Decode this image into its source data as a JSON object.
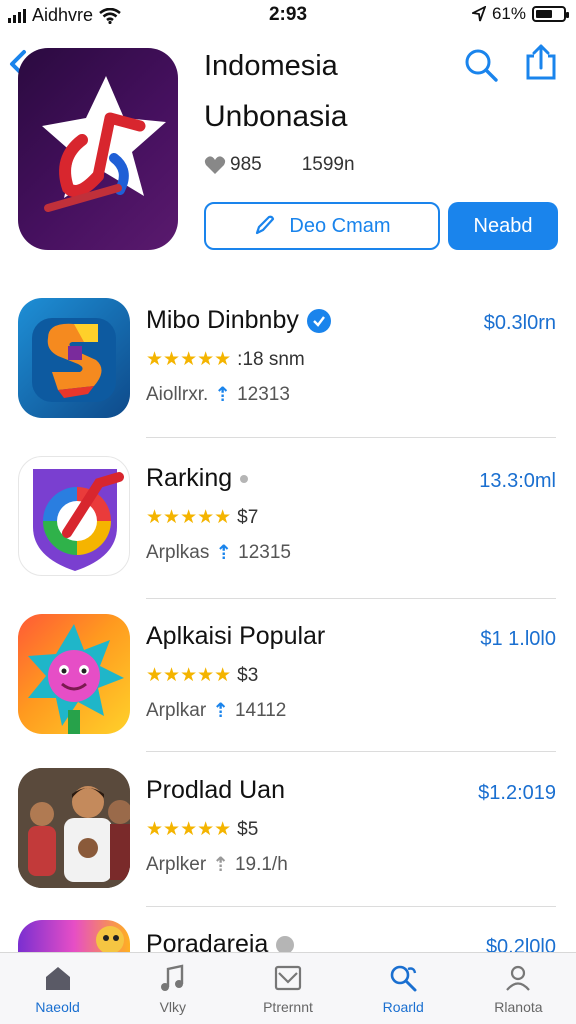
{
  "status_bar": {
    "carrier": "Aidhvre",
    "time": "2:93",
    "battery": "61%",
    "battery_level": 0.61
  },
  "header": {
    "title": "Indomesia",
    "subtitle": "Unbonasia",
    "likes": "985",
    "count": "1599n",
    "outline_button": "Deo Cmam",
    "primary_button": "Neabd"
  },
  "list": [
    {
      "name": "Mibo Dinbnby",
      "badge": "verified",
      "price": "$0.3l0rn",
      "rating_text": ":18 snm",
      "category": "Aiollrxr.",
      "downloads": "12313"
    },
    {
      "name": "Rarking",
      "badge": "dot",
      "price": "13.3:0ml",
      "rating_text": "$7",
      "category": "Arplkas",
      "downloads": "12315"
    },
    {
      "name": "Aplkaisi Popular",
      "badge": "",
      "price": "$1 1.l0l0",
      "rating_text": "$3",
      "category": "Arplkar",
      "downloads": "14112"
    },
    {
      "name": "Prodlad Uan",
      "badge": "",
      "price": "$1.2:019",
      "rating_text": "$5",
      "category": "Arplker",
      "downloads": "19.1/h"
    },
    {
      "name": "Poradareia",
      "badge": "dot",
      "price": "$0.2l0l0",
      "rating_text": "",
      "category": "",
      "downloads": ""
    }
  ],
  "tabs": [
    {
      "label": "Naeold",
      "icon": "home-icon",
      "active": true
    },
    {
      "label": "Vlky",
      "icon": "music-icon",
      "active": false
    },
    {
      "label": "Ptrernnt",
      "icon": "inbox-icon",
      "active": false
    },
    {
      "label": "Roarld",
      "icon": "search-person-icon",
      "active": true
    },
    {
      "label": "Rlanota",
      "icon": "profile-icon",
      "active": false
    }
  ],
  "colors": {
    "accent": "#1a84ec",
    "price": "#1a6fd0",
    "star": "#f4b400"
  }
}
